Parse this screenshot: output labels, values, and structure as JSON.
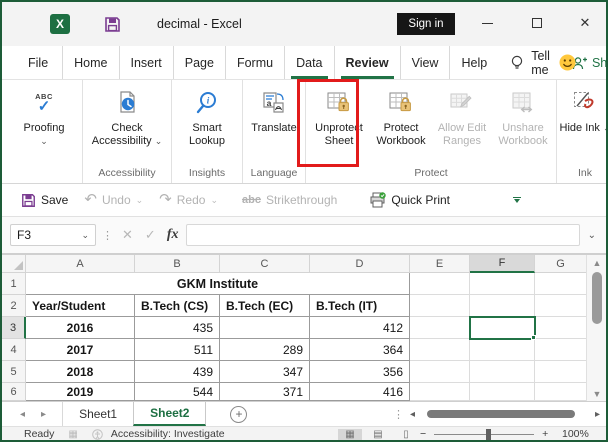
{
  "colors": {
    "excel_green": "#217346",
    "annotation_red": "#e21b1b",
    "save_purple": "#7b3d91",
    "lock_gold": "#e2ba6c",
    "smiley_yellow": "#ffc83d",
    "disabled_gray": "#b3b3b3"
  },
  "title_bar": {
    "title": "decimal  -  Excel",
    "sign_in_label": "Sign in"
  },
  "tabs": {
    "items": [
      "File",
      "Home",
      "Insert",
      "Page",
      "Formu",
      "Data",
      "Review",
      "View",
      "Help"
    ],
    "selected": "Review",
    "tell_me": "Tell me",
    "share": "Share"
  },
  "ribbon": {
    "proofing": {
      "label": "Proofing"
    },
    "check_accessibility": {
      "label": "Check Accessibility"
    },
    "smart_lookup": {
      "label": "Smart Lookup"
    },
    "translate": {
      "label": "Translate"
    },
    "unprotect_sheet": {
      "label": "Unprotect Sheet"
    },
    "protect_workbook": {
      "label": "Protect Workbook"
    },
    "allow_edit_ranges": {
      "label": "Allow Edit Ranges"
    },
    "unshare_workbook": {
      "label": "Unshare Workbook"
    },
    "hide_ink": {
      "label": "Hide Ink"
    },
    "groups": {
      "accessibility": "Accessibility",
      "insights": "Insights",
      "language": "Language",
      "protect": "Protect",
      "ink": "Ink"
    }
  },
  "qat": {
    "save": "Save",
    "undo": "Undo",
    "redo": "Redo",
    "strikethrough": "Strikethrough",
    "strike_abc": "abc",
    "quick_print": "Quick Print"
  },
  "formula_bar": {
    "name_box": "F3",
    "fx": "fx"
  },
  "grid": {
    "column_headers": [
      "A",
      "B",
      "C",
      "D",
      "E",
      "F",
      "G"
    ],
    "row_headers": [
      "1",
      "2",
      "3",
      "4",
      "5",
      "6"
    ],
    "selected_cell": "F3",
    "title": "GKM Institute",
    "table_headers": [
      "Year/Student",
      "B.Tech (CS)",
      "B.Tech (EC)",
      "B.Tech (IT)"
    ],
    "data_rows": [
      [
        "2016",
        "435",
        "",
        "412"
      ],
      [
        "2017",
        "511",
        "289",
        "364"
      ],
      [
        "2018",
        "439",
        "347",
        "356"
      ],
      [
        "2019",
        "544",
        "371",
        "416"
      ]
    ]
  },
  "sheet_tabs": {
    "sheet1": "Sheet1",
    "sheet2": "Sheet2",
    "active": "Sheet2"
  },
  "status_bar": {
    "ready": "Ready",
    "accessibility": "Accessibility: Investigate",
    "zoom_level": "100%"
  }
}
